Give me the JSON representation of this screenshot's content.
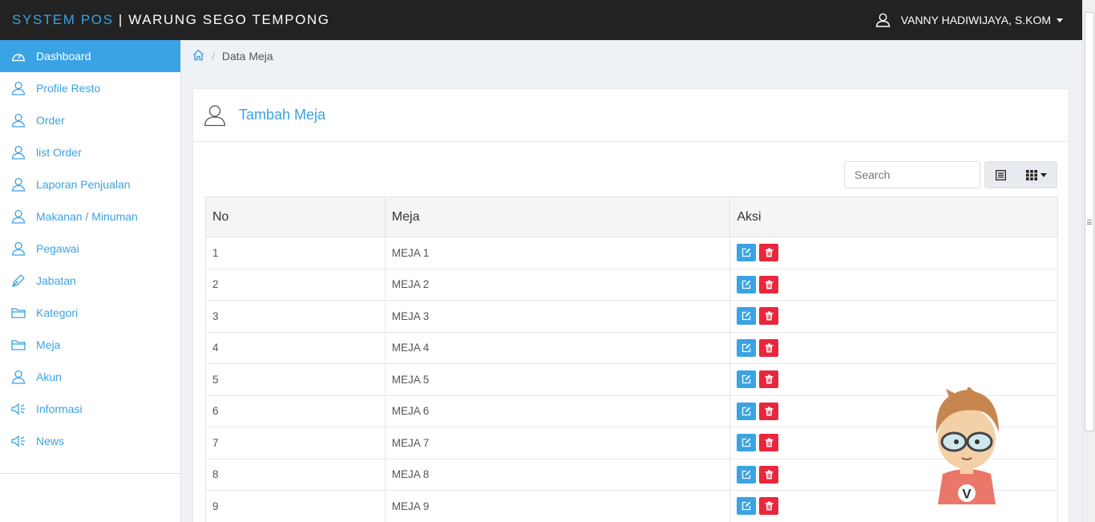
{
  "topbar": {
    "brand_accent": "SYSTEM POS",
    "brand_rest": " | WARUNG SEGO TEMPONG",
    "user_name": "VANNY HADIWIJAYA, S.KOM"
  },
  "sidebar": {
    "items": [
      {
        "label": "Dashboard",
        "icon": "dashboard-icon"
      },
      {
        "label": "Profile Resto",
        "icon": "user-icon"
      },
      {
        "label": "Order",
        "icon": "user-icon"
      },
      {
        "label": "list Order",
        "icon": "user-icon"
      },
      {
        "label": "Laporan Penjualan",
        "icon": "user-icon"
      },
      {
        "label": "Makanan / Minuman",
        "icon": "user-icon"
      },
      {
        "label": "Pegawai",
        "icon": "user-icon"
      },
      {
        "label": "Jabatan",
        "icon": "pen-icon"
      },
      {
        "label": "Kategori",
        "icon": "folder-icon"
      },
      {
        "label": "Meja",
        "icon": "folder-icon"
      },
      {
        "label": "Akun",
        "icon": "user-icon"
      },
      {
        "label": "Informasi",
        "icon": "megaphone-icon"
      },
      {
        "label": "News",
        "icon": "megaphone-icon"
      }
    ]
  },
  "breadcrumb": {
    "current": "Data Meja"
  },
  "panel": {
    "title": "Tambah Meja"
  },
  "search": {
    "placeholder": "Search"
  },
  "table": {
    "headers": [
      "No",
      "Meja",
      "Aksi"
    ],
    "rows": [
      {
        "no": "1",
        "meja": "MEJA 1"
      },
      {
        "no": "2",
        "meja": "MEJA 2"
      },
      {
        "no": "3",
        "meja": "MEJA 3"
      },
      {
        "no": "4",
        "meja": "MEJA 4"
      },
      {
        "no": "5",
        "meja": "MEJA 5"
      },
      {
        "no": "6",
        "meja": "MEJA 6"
      },
      {
        "no": "7",
        "meja": "MEJA 7"
      },
      {
        "no": "8",
        "meja": "MEJA 8"
      },
      {
        "no": "9",
        "meja": "MEJA 9"
      }
    ]
  },
  "mascot": {
    "badge_letter": "V"
  },
  "colors": {
    "accent": "#3aa3e3",
    "danger": "#e8263c",
    "topbar": "#222222"
  }
}
